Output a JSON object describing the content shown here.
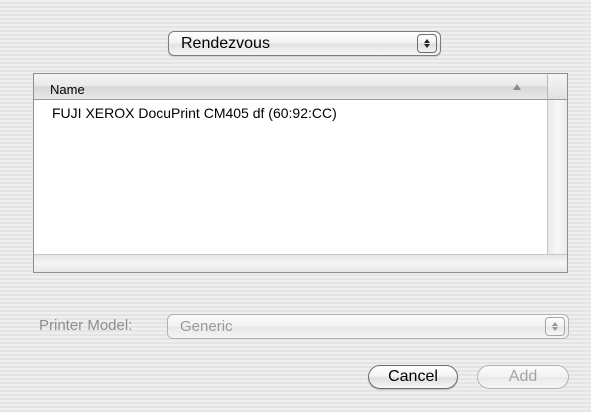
{
  "connection_popup": {
    "value": "Rendezvous"
  },
  "printer_list": {
    "columns": [
      {
        "label": "Name",
        "sorted": "ascending"
      }
    ],
    "rows": [
      {
        "name": "FUJI XEROX DocuPrint CM405 df (60:92:CC)"
      }
    ]
  },
  "printer_model": {
    "label": "Printer Model:",
    "value": "Generic",
    "enabled": false
  },
  "buttons": {
    "cancel_label": "Cancel",
    "add_label": "Add",
    "add_enabled": false
  },
  "icons": {
    "popup_arrows": "up-down-arrows-icon",
    "sort_indicator": "sort-ascending-icon"
  }
}
